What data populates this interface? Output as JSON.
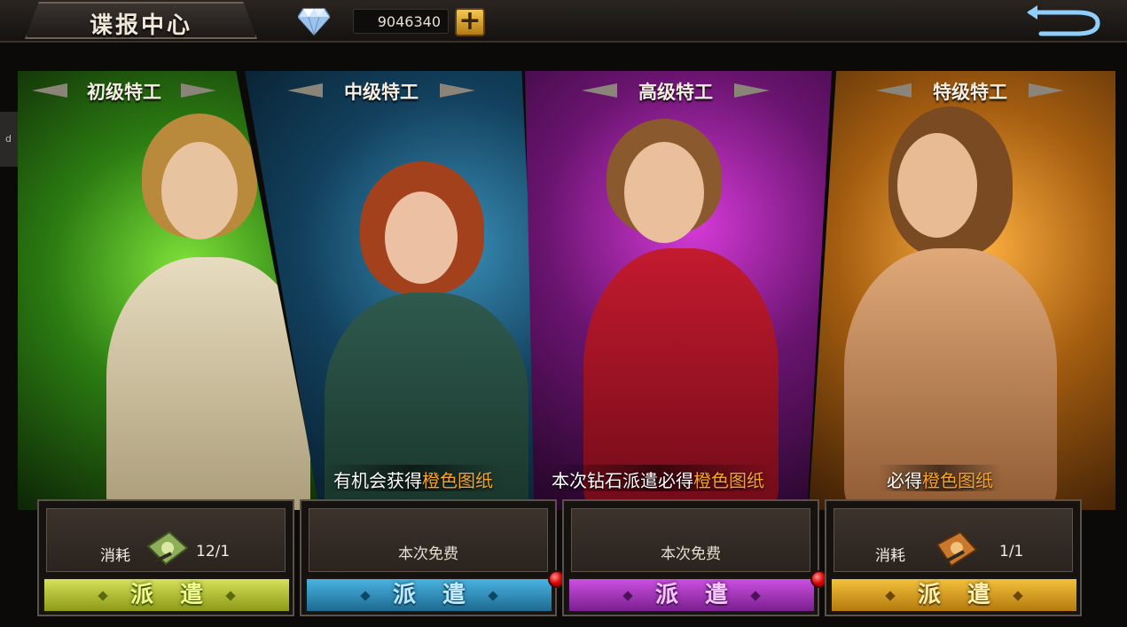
{
  "header": {
    "title": "谍报中心",
    "currency_value": "9046340",
    "currency_icon": "diamond-icon",
    "add_icon": "plus-icon",
    "back_icon": "back-arrow-icon"
  },
  "side_tab": {
    "label": "d"
  },
  "panels": [
    {
      "label": "初级特工",
      "theme_color": "#3fa51f"
    },
    {
      "label": "中级特工",
      "theme_color": "#1e6a94"
    },
    {
      "label": "高级特工",
      "theme_color": "#a226a8"
    },
    {
      "label": "特级特工",
      "theme_color": "#d98a22"
    }
  ],
  "captions": [
    {
      "prefix": "有机会获得",
      "highlight": "橙色图纸"
    },
    {
      "prefix": "本次钻石派遣必得",
      "highlight": "橙色图纸"
    },
    {
      "prefix": "必得",
      "highlight": "橙色图纸"
    }
  ],
  "cards": [
    {
      "cost_label": "消耗",
      "cost_value": "12/1",
      "item_icon": "green-blueprint-icon",
      "button": "派遣"
    },
    {
      "free_text": "本次免费",
      "button": "派遣",
      "notification": true
    },
    {
      "free_text": "本次免费",
      "button": "派遣",
      "notification": true
    },
    {
      "cost_label": "消耗",
      "cost_value": "1/1",
      "item_icon": "orange-blueprint-icon",
      "button": "派遣"
    }
  ]
}
